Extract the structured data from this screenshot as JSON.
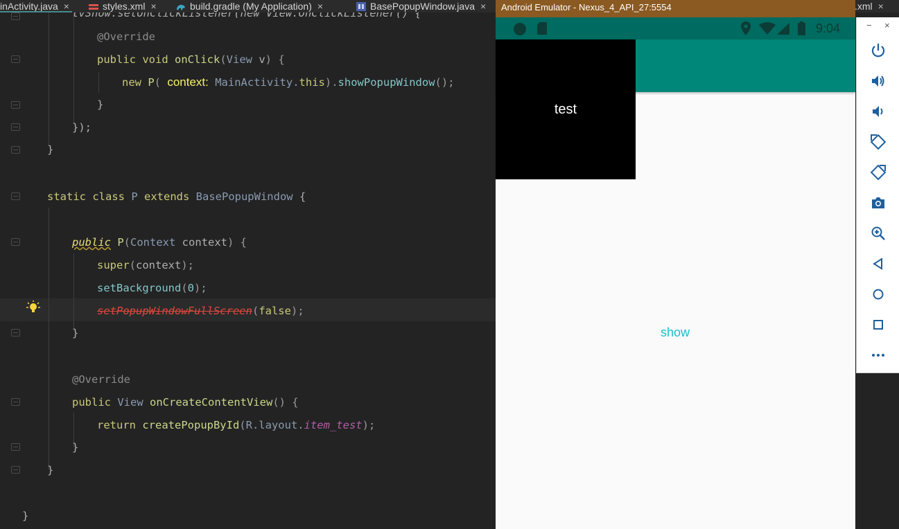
{
  "ide": {
    "tabs": [
      {
        "label": "inActivity.java",
        "icon": "java-file-icon",
        "active": true
      },
      {
        "label": "styles.xml",
        "icon": "xml-values-icon"
      },
      {
        "label": "build.gradle (My Application)",
        "icon": "gradle-icon"
      },
      {
        "label": "BasePopupWindow.java",
        "icon": "java-class-icon"
      },
      {
        "label": ".xml",
        "icon": "xml-file-icon"
      }
    ],
    "close_glyph": "×",
    "code": {
      "l0": {
        "a": "tvShow.setOnClickListener(new View.OnClickListener() {"
      },
      "l1": {
        "a": "@Override"
      },
      "l2": {
        "a": "public void ",
        "b": "onClick",
        "c": "(",
        "d": "View ",
        "e": "v",
        "f": ") {"
      },
      "l3": {
        "a": "new ",
        "b": "P",
        "c": "( ",
        "d": "context:",
        "e": " MainActivity.",
        "f": "this",
        "g": ").",
        "h": "showPopupWindow",
        "i": "();"
      },
      "l4": {
        "a": "}"
      },
      "l5": {
        "a": "});"
      },
      "l6": {
        "a": "}"
      },
      "l7": {
        "a": "static class ",
        "b": "P ",
        "c": "extends ",
        "d": "BasePopupWindow ",
        "e": "{"
      },
      "l8": {
        "a": "public",
        "b": " P",
        "c": "(",
        "d": "Context ",
        "e": "context",
        "f": ") {"
      },
      "l9": {
        "a": "super",
        "b": "(",
        "c": "context",
        "d": ");"
      },
      "l10": {
        "a": "setBackground",
        "b": "(",
        "c": "0",
        "d": ");"
      },
      "l11": {
        "a": "setPopupWindowFullScreen",
        "b": "(",
        "c": "false",
        "d": ");"
      },
      "l12": {
        "a": "}"
      },
      "l13": {
        "a": "@Override"
      },
      "l14": {
        "a": "public ",
        "b": "View ",
        "c": "onCreateContentView",
        "d": "() {"
      },
      "l15": {
        "a": "return ",
        "b": "createPopupById",
        "c": "(R.layout.",
        "d": "item_test",
        "e": ");"
      },
      "l16": {
        "a": "}"
      },
      "l17": {
        "a": "}"
      },
      "l18": {
        "a": "}"
      }
    }
  },
  "emulator": {
    "title": "Android Emulator - Nexus_4_API_27:5554",
    "status_time": "9:04",
    "popup_text": "test",
    "show_button": "show",
    "window_controls": {
      "minimize": "−",
      "close": "×"
    },
    "colors": {
      "status_bar": "#006b60",
      "app_bar": "#00877a",
      "accent": "#18bfcf",
      "title_bar": "#8a5a22"
    },
    "toolbar_buttons": [
      "power-icon",
      "volume-up-icon",
      "volume-down-icon",
      "rotate-left-icon",
      "rotate-right-icon",
      "camera-icon",
      "zoom-icon",
      "back-icon",
      "home-icon",
      "overview-icon",
      "more-icon"
    ]
  }
}
